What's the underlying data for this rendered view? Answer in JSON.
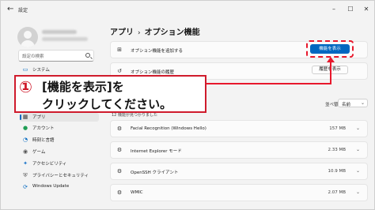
{
  "window": {
    "title": "設定",
    "back_icon": "back-arrow-icon",
    "controls": [
      "minimize-icon",
      "maximize-icon",
      "close-icon"
    ]
  },
  "sidebar": {
    "search_placeholder": "設定の検索",
    "items": [
      {
        "label": "システム",
        "icon": "system-icon",
        "color": "#0067c0"
      },
      {
        "label": "アプリ",
        "icon": "apps-icon",
        "color": "#3a3a3a",
        "active": true
      },
      {
        "label": "アカウント",
        "icon": "account-icon",
        "color": "#1f9d55"
      },
      {
        "label": "時刻と言語",
        "icon": "time-language-icon",
        "color": "#0067c0"
      },
      {
        "label": "ゲーム",
        "icon": "gaming-icon",
        "color": "#555555"
      },
      {
        "label": "アクセシビリティ",
        "icon": "accessibility-icon",
        "color": "#1a73c8"
      },
      {
        "label": "プライバシーとセキュリティ",
        "icon": "shield-icon",
        "color": "#555555"
      },
      {
        "label": "Windows Update",
        "icon": "update-icon",
        "color": "#0067c0"
      }
    ]
  },
  "breadcrumb": {
    "parent": "アプリ",
    "separator": "›",
    "current": "オプション機能"
  },
  "add_feature": {
    "label": "オプション機能を追加する",
    "button": "機能を表示"
  },
  "history": {
    "label": "オプション機能の履歴",
    "button": "履歴を表示"
  },
  "installed": {
    "count_label": "12 機能が見つかりました",
    "sort_label": "並べ替え:",
    "sort_value": "名前",
    "items": [
      {
        "name": "Facial Recognition (Windows Hello)",
        "size": "157 MB"
      },
      {
        "name": "Internet Explorer モード",
        "size": "2.33 MB"
      },
      {
        "name": "OpenSSH クライアント",
        "size": "10.9 MB"
      },
      {
        "name": "WMIC",
        "size": "2.07 MB"
      }
    ]
  },
  "callout": {
    "number": "①",
    "line1": "[機能を表示]を",
    "line2": "クリックしてください。",
    "color": "#cf1b2c"
  },
  "colors": {
    "accent": "#0067c0",
    "highlight": "#e8182c"
  }
}
